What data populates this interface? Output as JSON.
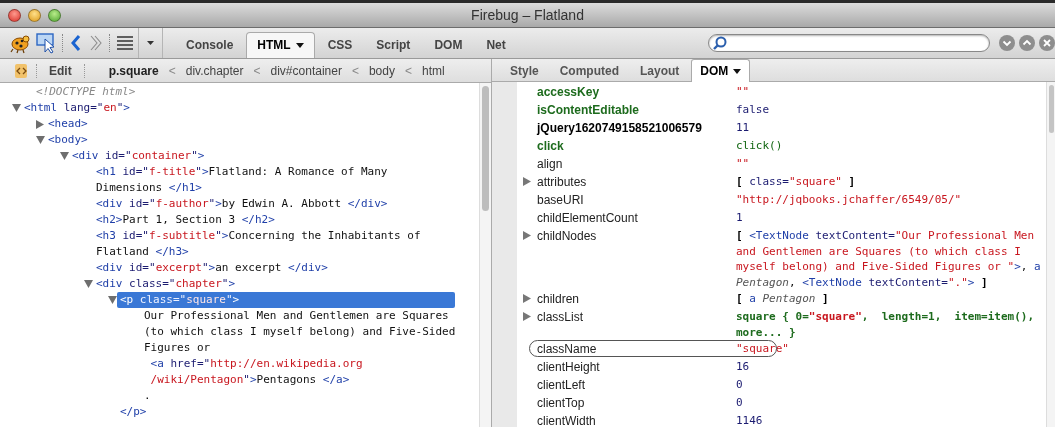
{
  "window": {
    "title": "Firebug – Flatland"
  },
  "toolbar": {
    "tabs": [
      {
        "label": "Console",
        "selected": false,
        "has_menu": false
      },
      {
        "label": "HTML",
        "selected": true,
        "has_menu": true
      },
      {
        "label": "CSS",
        "selected": false,
        "has_menu": false
      },
      {
        "label": "Script",
        "selected": false,
        "has_menu": false
      },
      {
        "label": "DOM",
        "selected": false,
        "has_menu": false
      },
      {
        "label": "Net",
        "selected": false,
        "has_menu": false
      }
    ]
  },
  "html_panel": {
    "edit_button": "Edit",
    "breadcrumbs": [
      {
        "kind": "crumb",
        "label": "p.square",
        "selected": true
      },
      {
        "kind": "separator",
        "label": "<"
      },
      {
        "kind": "crumb",
        "label": "div.chapter",
        "selected": false
      },
      {
        "kind": "separator",
        "label": "<"
      },
      {
        "kind": "crumb",
        "label": "div#container",
        "selected": false
      },
      {
        "kind": "separator",
        "label": "<"
      },
      {
        "kind": "crumb",
        "label": "body",
        "selected": false
      },
      {
        "kind": "separator",
        "label": "<"
      },
      {
        "kind": "crumb",
        "label": "html",
        "selected": false
      }
    ],
    "tree": [
      {
        "selected": false,
        "lines": [
          [
            {
              "kind": "doctype",
              "t": "<!DOCTYPE html>"
            }
          ]
        ]
      },
      {
        "expanded": true,
        "selected": false,
        "lines": [
          [
            {
              "kind": "tag",
              "t": "<html"
            },
            {
              "kind": "attr",
              "t": " lang=\""
            },
            {
              "kind": "value",
              "t": "en"
            },
            {
              "kind": "attr",
              "t": "\""
            },
            {
              "kind": "tag",
              "t": ">"
            }
          ]
        ],
        "children": [
          {
            "expanded": false,
            "selected": false,
            "lines": [
              [
                {
                  "kind": "tag",
                  "t": "<head>"
                }
              ]
            ]
          },
          {
            "expanded": true,
            "selected": false,
            "lines": [
              [
                {
                  "kind": "tag",
                  "t": "<body>"
                }
              ]
            ],
            "children": [
              {
                "expanded": true,
                "selected": false,
                "lines": [
                  [
                    {
                      "kind": "tag",
                      "t": "<div"
                    },
                    {
                      "kind": "attr",
                      "t": " id=\""
                    },
                    {
                      "kind": "value",
                      "t": "container"
                    },
                    {
                      "kind": "attr",
                      "t": "\""
                    },
                    {
                      "kind": "tag",
                      "t": ">"
                    }
                  ]
                ],
                "children": [
                  {
                    "selected": false,
                    "lines": [
                      [
                        {
                          "kind": "tag",
                          "t": "<h1"
                        },
                        {
                          "kind": "attr",
                          "t": " id=\""
                        },
                        {
                          "kind": "value",
                          "t": "f-title"
                        },
                        {
                          "kind": "attr",
                          "t": "\""
                        },
                        {
                          "kind": "tag",
                          "t": ">"
                        },
                        {
                          "kind": "text",
                          "t": "Flatland: A Romance of Many"
                        }
                      ],
                      [
                        {
                          "kind": "text",
                          "t": "Dimensions "
                        },
                        {
                          "kind": "tag",
                          "t": "</h1>"
                        }
                      ]
                    ]
                  },
                  {
                    "selected": false,
                    "lines": [
                      [
                        {
                          "kind": "tag",
                          "t": "<div"
                        },
                        {
                          "kind": "attr",
                          "t": " id=\""
                        },
                        {
                          "kind": "value",
                          "t": "f-author"
                        },
                        {
                          "kind": "attr",
                          "t": "\""
                        },
                        {
                          "kind": "tag",
                          "t": ">"
                        },
                        {
                          "kind": "text",
                          "t": "by Edwin A. Abbott "
                        },
                        {
                          "kind": "tag",
                          "t": "</div>"
                        }
                      ]
                    ]
                  },
                  {
                    "selected": false,
                    "lines": [
                      [
                        {
                          "kind": "tag",
                          "t": "<h2>"
                        },
                        {
                          "kind": "text",
                          "t": "Part 1, Section 3 "
                        },
                        {
                          "kind": "tag",
                          "t": "</h2>"
                        }
                      ]
                    ]
                  },
                  {
                    "selected": false,
                    "lines": [
                      [
                        {
                          "kind": "tag",
                          "t": "<h3"
                        },
                        {
                          "kind": "attr",
                          "t": " id=\""
                        },
                        {
                          "kind": "value",
                          "t": "f-subtitle"
                        },
                        {
                          "kind": "attr",
                          "t": "\""
                        },
                        {
                          "kind": "tag",
                          "t": ">"
                        },
                        {
                          "kind": "text",
                          "t": "Concerning the Inhabitants of"
                        }
                      ],
                      [
                        {
                          "kind": "text",
                          "t": "Flatland "
                        },
                        {
                          "kind": "tag",
                          "t": "</h3>"
                        }
                      ]
                    ]
                  },
                  {
                    "selected": false,
                    "lines": [
                      [
                        {
                          "kind": "tag",
                          "t": "<div"
                        },
                        {
                          "kind": "attr",
                          "t": " id=\""
                        },
                        {
                          "kind": "value",
                          "t": "excerpt"
                        },
                        {
                          "kind": "attr",
                          "t": "\""
                        },
                        {
                          "kind": "tag",
                          "t": ">"
                        },
                        {
                          "kind": "text",
                          "t": "an excerpt "
                        },
                        {
                          "kind": "tag",
                          "t": "</div>"
                        }
                      ]
                    ]
                  },
                  {
                    "expanded": true,
                    "selected": false,
                    "lines": [
                      [
                        {
                          "kind": "tag",
                          "t": "<div"
                        },
                        {
                          "kind": "attr",
                          "t": " class=\""
                        },
                        {
                          "kind": "value",
                          "t": "chapter"
                        },
                        {
                          "kind": "attr",
                          "t": "\""
                        },
                        {
                          "kind": "tag",
                          "t": ">"
                        }
                      ]
                    ],
                    "children": [
                      {
                        "expanded": true,
                        "selected": true,
                        "lines": [
                          [
                            {
                              "kind": "tag",
                              "t": "<p"
                            },
                            {
                              "kind": "attr",
                              "t": " class=\""
                            },
                            {
                              "kind": "value",
                              "t": "square"
                            },
                            {
                              "kind": "attr",
                              "t": "\""
                            },
                            {
                              "kind": "tag",
                              "t": ">"
                            }
                          ]
                        ],
                        "close": "</p>",
                        "children": [
                          {
                            "selected": false,
                            "lines": [
                              [
                                {
                                  "kind": "text",
                                  "t": "Our Professional Men and Gentlemen are Squares"
                                }
                              ],
                              [
                                {
                                  "kind": "text",
                                  "t": "(to which class I myself belong) and Five-Sided"
                                }
                              ],
                              [
                                {
                                  "kind": "text",
                                  "t": "Figures or"
                                }
                              ]
                            ]
                          },
                          {
                            "selected": false,
                            "lines": [
                              [
                                {
                                  "kind": "tag",
                                  "t": " <a"
                                },
                                {
                                  "kind": "attr",
                                  "t": " href=\""
                                },
                                {
                                  "kind": "value",
                                  "t": "http://en.wikipedia.org"
                                }
                              ],
                              [
                                {
                                  "kind": "value",
                                  "t": " /wiki/Pentagon"
                                },
                                {
                                  "kind": "attr",
                                  "t": "\""
                                },
                                {
                                  "kind": "tag",
                                  "t": ">"
                                },
                                {
                                  "kind": "text",
                                  "t": "Pentagons "
                                },
                                {
                                  "kind": "tag",
                                  "t": "</a>"
                                }
                              ]
                            ]
                          },
                          {
                            "selected": false,
                            "lines": [
                              [
                                {
                                  "kind": "text",
                                  "t": "."
                                }
                              ]
                            ]
                          }
                        ]
                      }
                    ]
                  }
                ]
              }
            ]
          }
        ]
      }
    ]
  },
  "side_panel": {
    "tabs": [
      {
        "label": "Style",
        "selected": false,
        "has_menu": false
      },
      {
        "label": "Computed",
        "selected": false,
        "has_menu": false
      },
      {
        "label": "Layout",
        "selected": false,
        "has_menu": false
      },
      {
        "label": "DOM",
        "selected": true,
        "has_menu": true
      }
    ],
    "properties": [
      {
        "name": "accessKey",
        "kind": "user",
        "expandable": false,
        "circled": false,
        "value": [
          [
            {
              "kind": "string",
              "t": "\"\""
            }
          ]
        ]
      },
      {
        "name": "isContentEditable",
        "kind": "user",
        "expandable": false,
        "circled": false,
        "value": [
          [
            {
              "kind": "number",
              "t": "false"
            }
          ]
        ]
      },
      {
        "name": "jQuery1620749158521006579",
        "kind": "expando",
        "expandable": false,
        "circled": false,
        "value": [
          [
            {
              "kind": "number",
              "t": "11"
            }
          ]
        ]
      },
      {
        "name": "click",
        "kind": "user",
        "expandable": false,
        "circled": false,
        "value": [
          [
            {
              "kind": "function",
              "t": "click()"
            }
          ]
        ]
      },
      {
        "name": "align",
        "kind": "prop",
        "expandable": false,
        "circled": false,
        "value": [
          [
            {
              "kind": "string",
              "t": "\"\""
            }
          ]
        ]
      },
      {
        "name": "attributes",
        "kind": "prop",
        "expandable": true,
        "circled": false,
        "value": [
          [
            {
              "kind": "bracket",
              "t": "[ "
            },
            {
              "kind": "attr",
              "t": "class="
            },
            {
              "kind": "string",
              "t": "\"square\""
            },
            {
              "kind": "bracket",
              "t": " ]"
            }
          ]
        ]
      },
      {
        "name": "baseURI",
        "kind": "prop",
        "expandable": false,
        "circled": false,
        "value": [
          [
            {
              "kind": "string",
              "t": "\"http://jqbooks.jchaffer/6549/05/\""
            }
          ]
        ]
      },
      {
        "name": "childElementCount",
        "kind": "prop",
        "expandable": false,
        "circled": false,
        "value": [
          [
            {
              "kind": "number",
              "t": "1"
            }
          ]
        ]
      },
      {
        "name": "childNodes",
        "kind": "prop",
        "expandable": true,
        "circled": false,
        "value": [
          [
            {
              "kind": "bracket",
              "t": "[ "
            },
            {
              "kind": "tag",
              "t": "<TextNode"
            },
            {
              "kind": "attr",
              "t": " textContent="
            },
            {
              "kind": "string",
              "t": "\"Our Professional Men"
            }
          ],
          [
            {
              "kind": "string",
              "t": "and Gentlemen are Squares (to which class I"
            }
          ],
          [
            {
              "kind": "string",
              "t": "myself belong) and Five-Sided Figures or \""
            },
            {
              "kind": "tag",
              "t": ">"
            },
            {
              "kind": "punct",
              "t": ", "
            },
            {
              "kind": "tag",
              "t": "a"
            }
          ],
          [
            {
              "kind": "italic",
              "t": "Pentagon"
            },
            {
              "kind": "punct",
              "t": ", "
            },
            {
              "kind": "tag",
              "t": "<TextNode"
            },
            {
              "kind": "attr",
              "t": " textContent="
            },
            {
              "kind": "string",
              "t": "\".\""
            },
            {
              "kind": "tag",
              "t": ">"
            },
            {
              "kind": "bracket",
              "t": " ]"
            }
          ]
        ]
      },
      {
        "name": "children",
        "kind": "prop",
        "expandable": true,
        "circled": false,
        "value": [
          [
            {
              "kind": "bracket",
              "t": "[ "
            },
            {
              "kind": "tag",
              "t": "a"
            },
            {
              "kind": "italic",
              "t": " Pentagon"
            },
            {
              "kind": "bracket",
              "t": " ]"
            }
          ]
        ]
      },
      {
        "name": "classList",
        "kind": "prop",
        "expandable": true,
        "circled": false,
        "value": [
          [
            {
              "kind": "list",
              "t": "square { 0="
            },
            {
              "kind": "listitem",
              "t": "\"square\""
            },
            {
              "kind": "list",
              "t": ",  length=1,  item=item(),"
            }
          ],
          [
            {
              "kind": "list",
              "t": "more... }"
            }
          ]
        ]
      },
      {
        "name": "className",
        "kind": "prop",
        "expandable": false,
        "circled": true,
        "value": [
          [
            {
              "kind": "string",
              "t": "\"square\""
            }
          ]
        ]
      },
      {
        "name": "clientHeight",
        "kind": "prop",
        "expandable": false,
        "circled": false,
        "value": [
          [
            {
              "kind": "number",
              "t": "16"
            }
          ]
        ]
      },
      {
        "name": "clientLeft",
        "kind": "prop",
        "expandable": false,
        "circled": false,
        "value": [
          [
            {
              "kind": "number",
              "t": "0"
            }
          ]
        ]
      },
      {
        "name": "clientTop",
        "kind": "prop",
        "expandable": false,
        "circled": false,
        "value": [
          [
            {
              "kind": "number",
              "t": "0"
            }
          ]
        ]
      },
      {
        "name": "clientWidth",
        "kind": "prop",
        "expandable": false,
        "circled": false,
        "value": [
          [
            {
              "kind": "number",
              "t": "1146"
            }
          ]
        ]
      }
    ]
  }
}
